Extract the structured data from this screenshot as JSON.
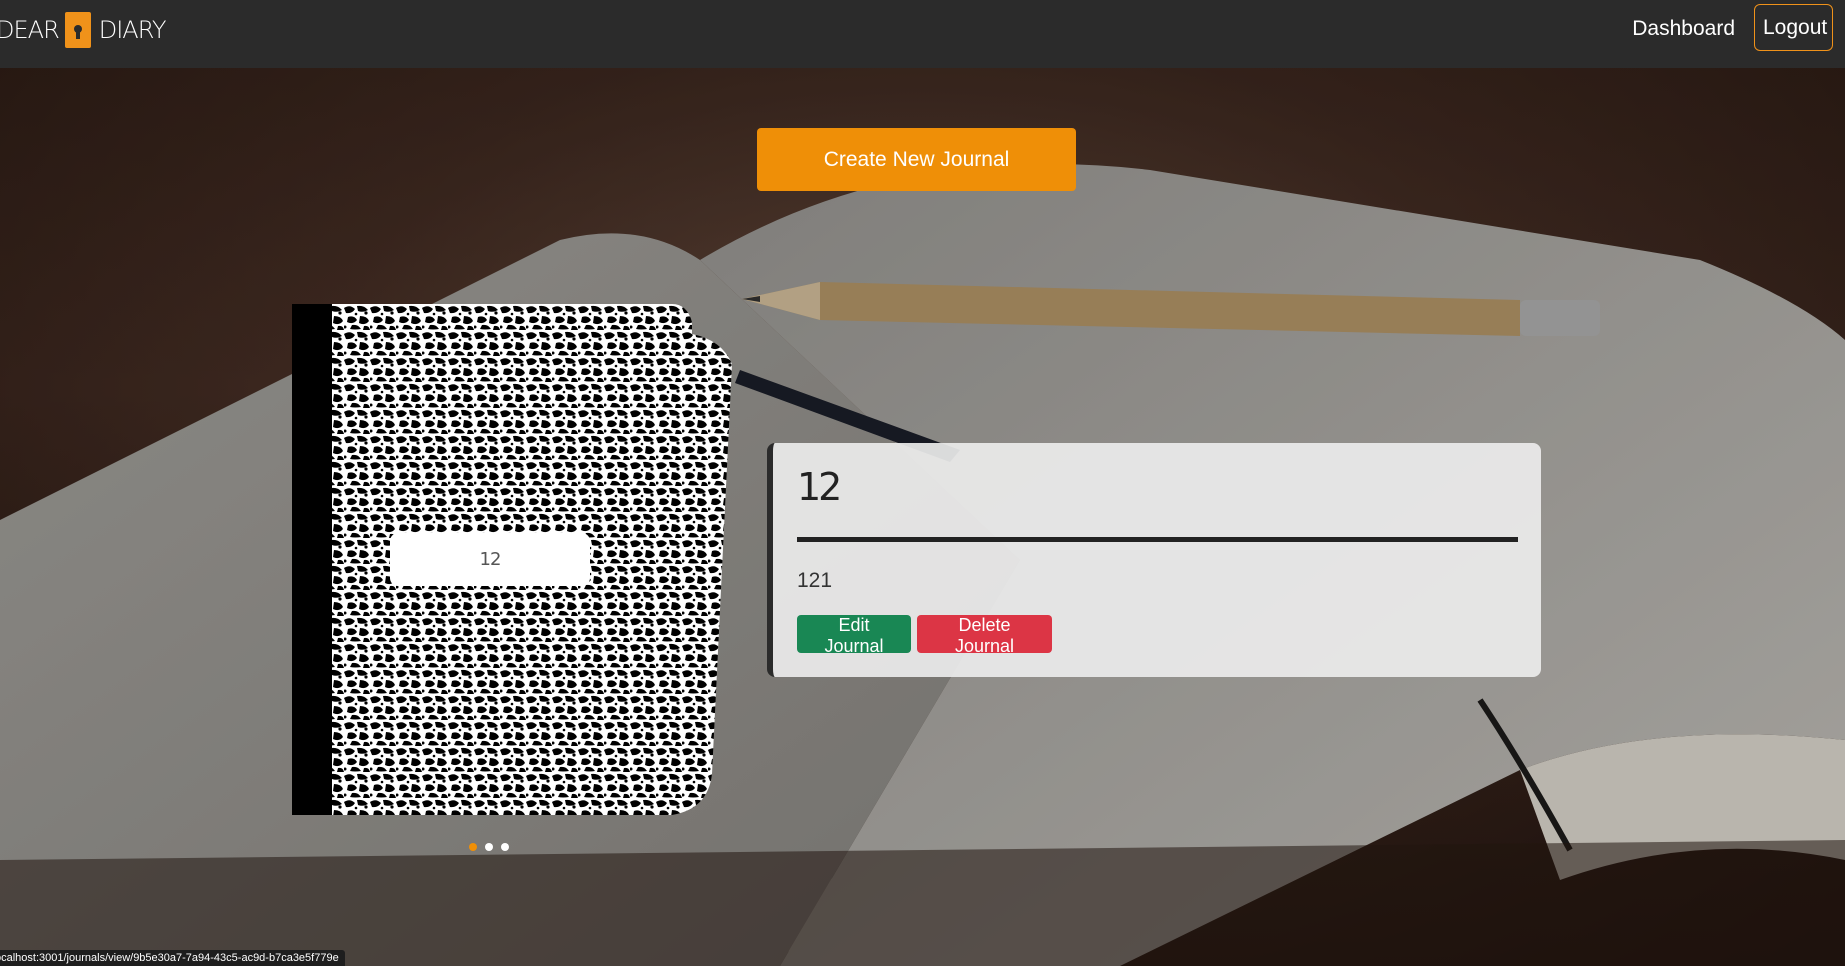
{
  "brand": {
    "left_text": "DEAR",
    "right_text": "DIARY",
    "lock_icon": "keyhole-lock-icon",
    "accent_color": "#f0921a"
  },
  "nav": {
    "dashboard_label": "Dashboard",
    "logout_label": "Logout"
  },
  "actions": {
    "create_label": "Create New Journal"
  },
  "carousel": {
    "cover_label": "12",
    "slides_count": 3,
    "active_index": 0
  },
  "journal": {
    "title": "12",
    "description": "121",
    "edit_label": "Edit Journal",
    "delete_label": "Delete Journal"
  },
  "colors": {
    "navbar": "#2b2b2b",
    "create_button": "#ef8f07",
    "edit_button": "#198754",
    "delete_button": "#dc3545"
  },
  "status": {
    "url": "ocalhost:3001/journals/view/9b5e30a7-7a94-43c5-ac9d-b7ca3e5f779e"
  }
}
